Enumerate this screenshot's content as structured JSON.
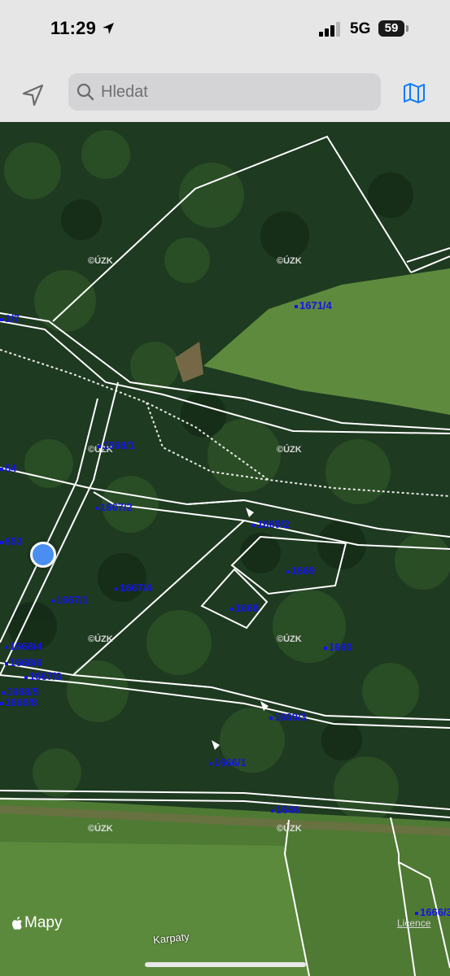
{
  "status_bar": {
    "time": "11:29",
    "network": "5G",
    "battery": "59"
  },
  "search": {
    "placeholder": "Hledat"
  },
  "icons": {
    "location": "location-arrow-icon",
    "search": "search-icon",
    "map": "map-icon"
  },
  "map": {
    "watermark": "©ÚZK",
    "parcels": [
      "1671/4",
      "1/7",
      "1568/1",
      "64",
      "1667/2",
      "1669/2",
      "653",
      "1669",
      "1667/4",
      "1668",
      "1667/1",
      "1660",
      "1668/4",
      "1668/6",
      "1667/3",
      "1668/5",
      "1668/8",
      "1669/3",
      "1666/1",
      "1646",
      "1666/3"
    ],
    "place_label": "Karpaty"
  },
  "attribution": "Mapy",
  "licence": "Licence",
  "colors": {
    "parcel_label": "#1414e6",
    "location_dot": "#4a8ef2",
    "boundary": "#ffffff"
  }
}
